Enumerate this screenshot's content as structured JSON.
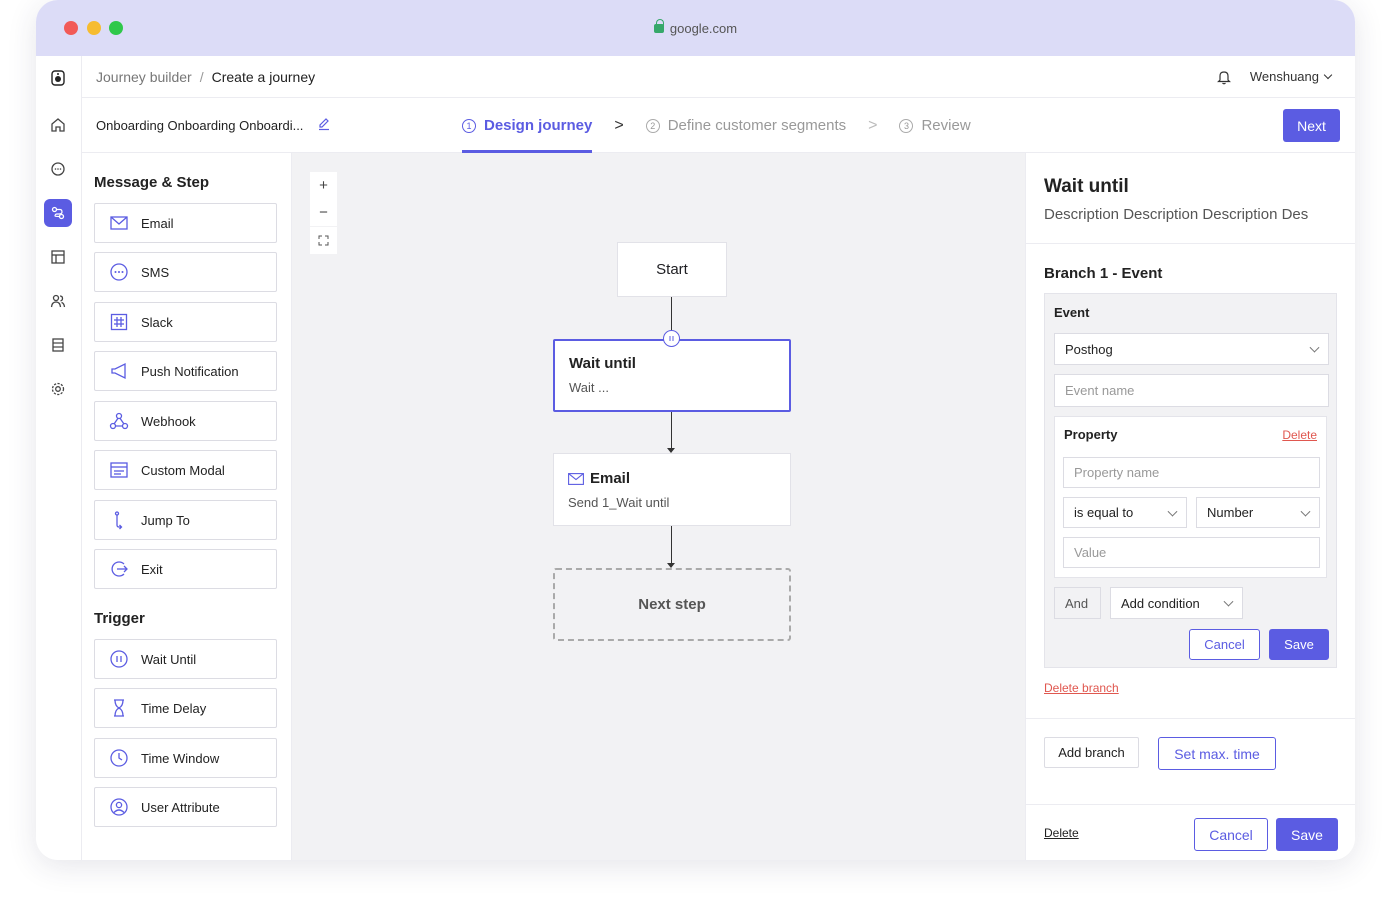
{
  "browser": {
    "url": "google.com"
  },
  "header": {
    "breadcrumb_root": "Journey builder",
    "breadcrumb_sep": "/",
    "breadcrumb_current": "Create a journey",
    "user_name": "Wenshuang"
  },
  "subheader": {
    "journey_name": "Onboarding Onboarding Onboardi...",
    "steps": [
      {
        "num": "1",
        "label": "Design journey"
      },
      {
        "num": "2",
        "label": "Define customer segments"
      },
      {
        "num": "3",
        "label": "Review"
      }
    ],
    "next_label": "Next"
  },
  "palette": {
    "message_heading": "Message & Step",
    "message_items": [
      "Email",
      "SMS",
      "Slack",
      "Push Notification",
      "Webhook",
      "Custom Modal",
      "Jump To",
      "Exit"
    ],
    "trigger_heading": "Trigger",
    "trigger_items": [
      "Wait Until",
      "Time Delay",
      "Time Window",
      "User Attribute"
    ]
  },
  "canvas": {
    "start_label": "Start",
    "wait_node": {
      "title": "Wait until",
      "sub": "Wait ..."
    },
    "email_node": {
      "title": "Email",
      "sub": "Send 1_Wait until"
    },
    "next_step_label": "Next step"
  },
  "panel": {
    "title": "Wait until",
    "description": "Description Description Description Des",
    "branch_title": "Branch 1 - Event",
    "event_label": "Event",
    "event_source": "Posthog",
    "event_name_placeholder": "Event name",
    "property_label": "Property",
    "property_delete": "Delete",
    "property_name_placeholder": "Property name",
    "operator": "is equal to",
    "value_type": "Number",
    "value_placeholder": "Value",
    "and_label": "And",
    "add_condition": "Add condition",
    "cancel": "Cancel",
    "save": "Save",
    "delete_branch": "Delete branch",
    "add_branch": "Add branch",
    "set_max_time": "Set max. time",
    "footer_delete": "Delete",
    "footer_cancel": "Cancel",
    "footer_save": "Save"
  },
  "colors": {
    "accent": "#5b5ce2",
    "danger": "#e0574f",
    "titlebar": "#dcdcf7"
  }
}
